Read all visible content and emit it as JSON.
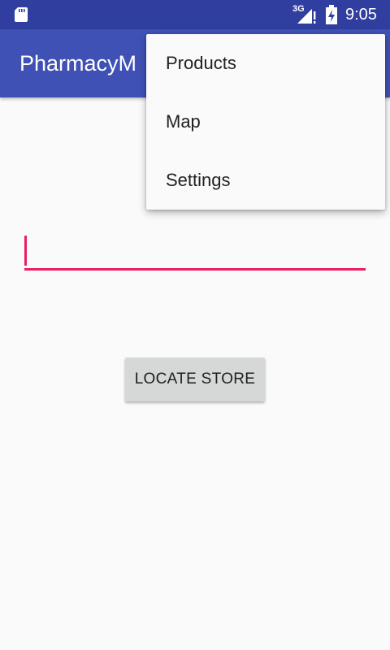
{
  "status_bar": {
    "network_label": "3G",
    "time": "9:05",
    "icons": [
      "sd-card-icon",
      "signal-icon",
      "battery-charging-icon"
    ]
  },
  "app_bar": {
    "title": "PharmacyM"
  },
  "menu": {
    "items": [
      {
        "label": "Products"
      },
      {
        "label": "Map"
      },
      {
        "label": "Settings"
      }
    ]
  },
  "form": {
    "search_value": "",
    "button_label": "LOCATE STORE"
  },
  "colors": {
    "status_bar": "#303f9f",
    "app_bar": "#3f51b5",
    "accent": "#e91e63",
    "background": "#fafafa",
    "button": "#d6d7d7"
  }
}
